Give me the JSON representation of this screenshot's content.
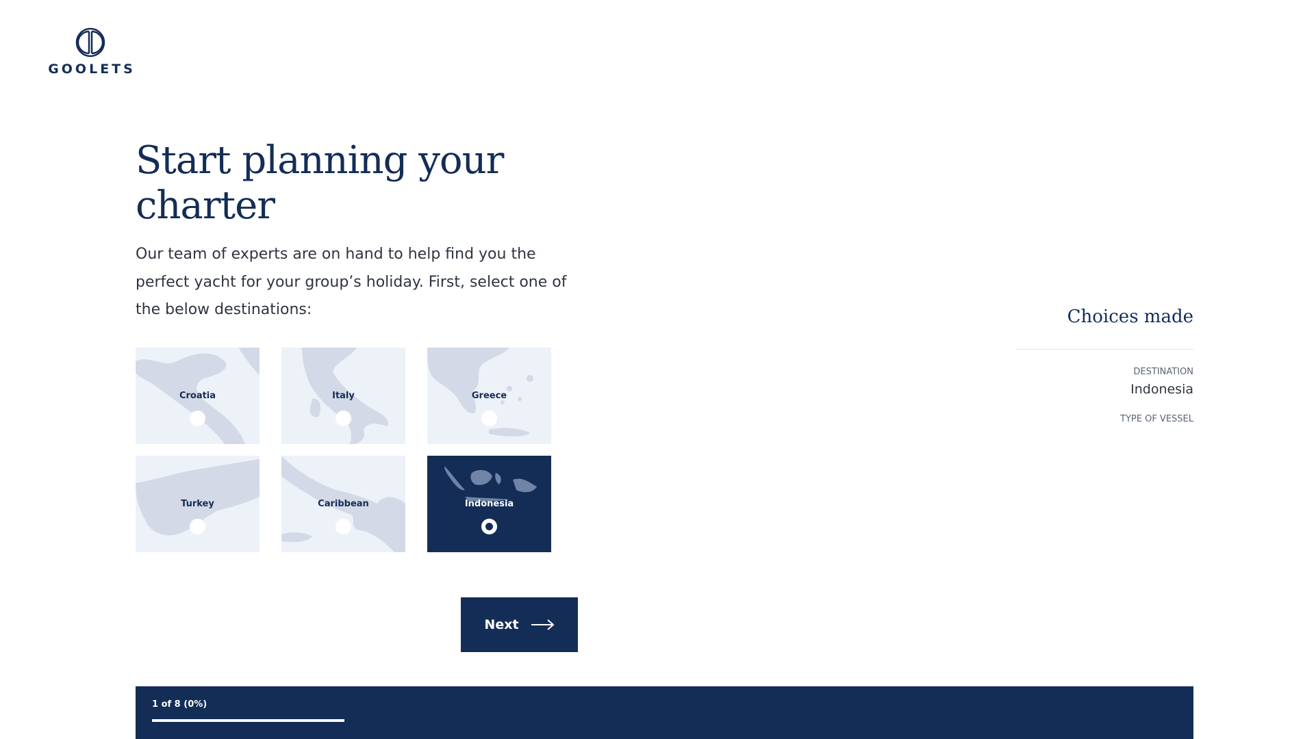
{
  "brand": {
    "name": "GOOLETS",
    "logo_icon": "goolets-monogram-icon"
  },
  "intro": {
    "title": "Start planning your charter",
    "body": "Our team of experts are on hand to help find you the perfect yacht for your group’s holiday. First, select one of the below destinations:"
  },
  "destinations": [
    {
      "label": "Croatia",
      "selected": false
    },
    {
      "label": "Italy",
      "selected": false
    },
    {
      "label": "Greece",
      "selected": false
    },
    {
      "label": "Turkey",
      "selected": false
    },
    {
      "label": "Caribbean",
      "selected": false
    },
    {
      "label": "Indonesia",
      "selected": true
    }
  ],
  "actions": {
    "next_label": "Next",
    "next_icon": "arrow-right-icon"
  },
  "choices": {
    "title": "Choices made",
    "destination_label": "DESTINATION",
    "destination_value": "Indonesia",
    "vessel_label": "TYPE OF VESSEL"
  },
  "progress": {
    "text": "1 of 8 (0%)",
    "percent": 0
  },
  "colors": {
    "navy": "#142d57",
    "tile_bg": "#edf1f8",
    "map_land": "#d3d9e6"
  }
}
